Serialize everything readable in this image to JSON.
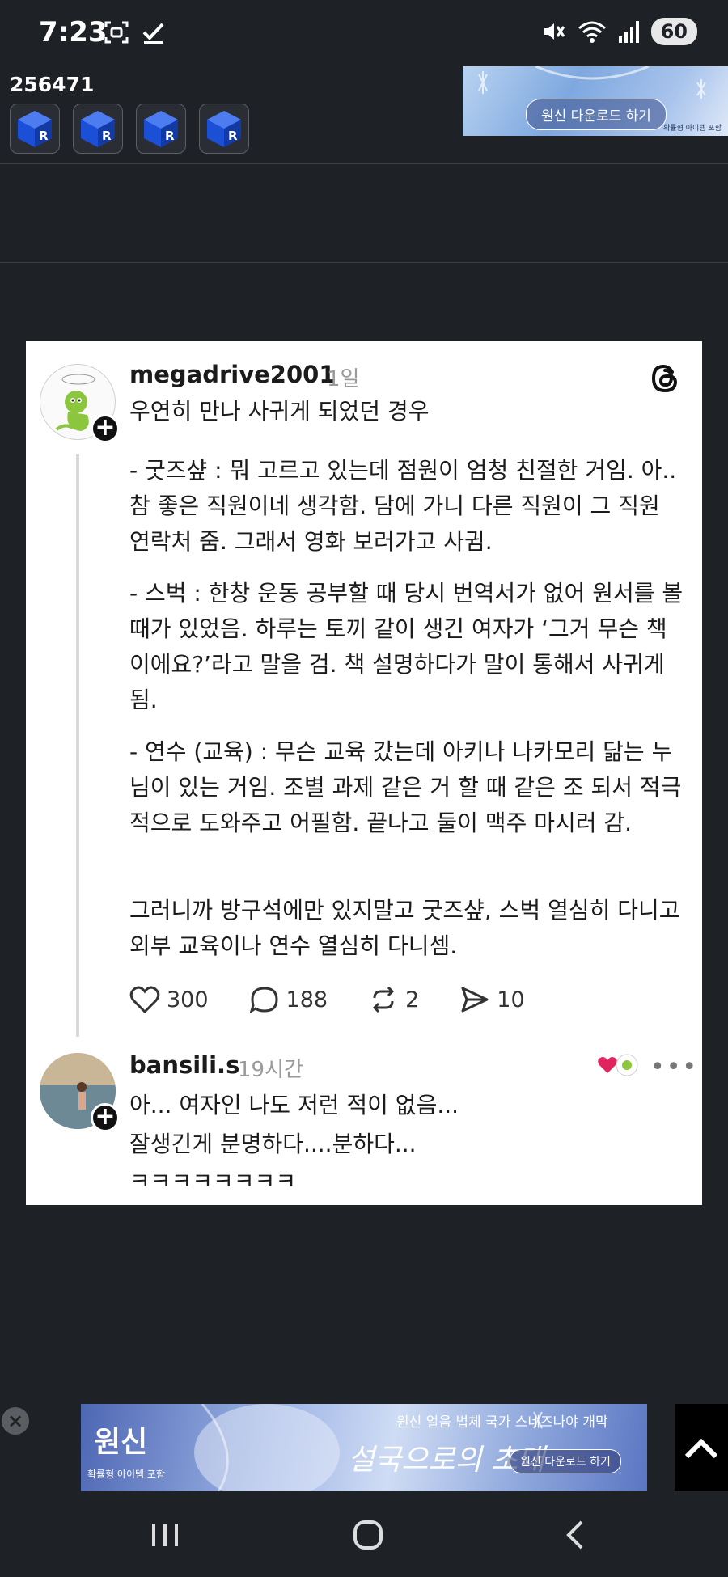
{
  "status_bar": {
    "time": "7:23",
    "battery": "60",
    "icons": [
      "screenshot-icon",
      "check-icon",
      "mute-icon",
      "wifi-icon",
      "signal-icon",
      "battery-icon"
    ]
  },
  "profile": {
    "user_id": "256471",
    "badge_count": 4,
    "badge_icon": "blue-cube-icon"
  },
  "top_banner": {
    "button": "원신 다운로드 하기",
    "fine_print": "확률형 아이템 포함"
  },
  "post": {
    "username": "megadrive2001",
    "time": "1일",
    "title": "우연히 만나 사귀게 되었던 경우",
    "paragraphs": [
      "- 굿즈샾 : 뭐 고르고 있는데 점원이 엄청 친절한 거임. 아.. 참 좋은 직원이네 생각함. 담에 가니 다른 직원이 그 직원 연락처 줌. 그래서 영화 보러가고 사귐.",
      "- 스벅 : 한창 운동 공부할 때 당시 번역서가 없어 원서를 볼 때가 있었음. 하루는 토끼 같이 생긴 여자가 ‘그거 무슨 책이에요?’라고 말을 검. 책 설명하다가 말이 통해서 사귀게 됨.",
      "- 연수 (교육) : 무슨 교육 갔는데 아키나 나카모리 닮는 누님이 있는 거임. 조별 과제 같은 거 할 때 같은 조 되서 적극적으로 도와주고 어필함. 끝나고 둘이 맥주 마시러 감.",
      "그러니까 방구석에만 있지말고 굿즈샾, 스벅 열심히 다니고 외부 교육이나 연수 열심히 다니셈."
    ],
    "likes": "300",
    "comments": "188",
    "reposts": "2",
    "shares": "10"
  },
  "reply": {
    "username": "bansili.s",
    "time": "19시간",
    "lines": [
      "아... 여자인 나도 저런 적이 없음...",
      "잘생긴게 분명하다....분하다...",
      "ㅋㅋㅋㅋㅋㅋㅋㅋ"
    ]
  },
  "bottom_ad": {
    "logo": "원신",
    "sub": "확률형 아이템 포함",
    "headline": "원신 얼음 법체 국가 스네즈나야 개막",
    "title": "설국으로의 초대",
    "button": "원신 다운로드 하기"
  },
  "colors": {
    "background": "#1e2227",
    "card": "#ffffff",
    "like_red": "#e0245e",
    "badge_blue": "#1b4fd6"
  }
}
